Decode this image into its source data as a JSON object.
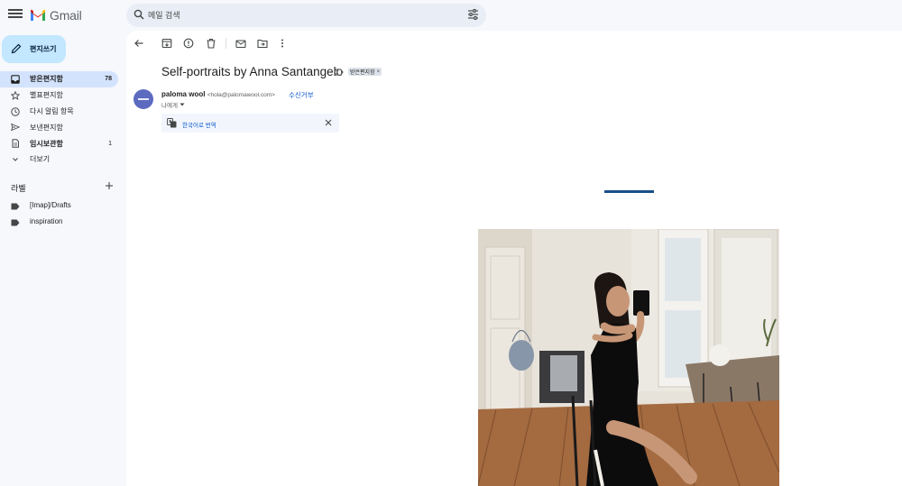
{
  "app": {
    "name": "Gmail"
  },
  "search": {
    "placeholder": "메일 검색"
  },
  "compose": {
    "label": "편지쓰기"
  },
  "nav": {
    "items": [
      {
        "label": "받은편지함",
        "count": "78"
      },
      {
        "label": "별표편지함",
        "count": ""
      },
      {
        "label": "다시 알림 항목",
        "count": ""
      },
      {
        "label": "보낸편지함",
        "count": ""
      },
      {
        "label": "임시보관함",
        "count": "1"
      },
      {
        "label": "더보기",
        "count": ""
      }
    ]
  },
  "labels": {
    "heading": "라벨",
    "items": [
      {
        "label": "[Imap]/Drafts"
      },
      {
        "label": "inspiration"
      }
    ]
  },
  "email": {
    "subject": "Self-portraits by Anna Santangelo",
    "inbox_chip": "받은편지함",
    "inbox_chip_close": "×",
    "sender_name": "paloma wool",
    "sender_email": "<hola@palomawool.com>",
    "unsubscribe": "수신거부",
    "to": "나에게",
    "translate": "한국어로 번역"
  },
  "colors": {
    "accent": "#0b57d0",
    "compose_bg": "#c2e7ff",
    "active_nav_bg": "#d3e3fd",
    "app_bg": "#f6f8fc"
  }
}
